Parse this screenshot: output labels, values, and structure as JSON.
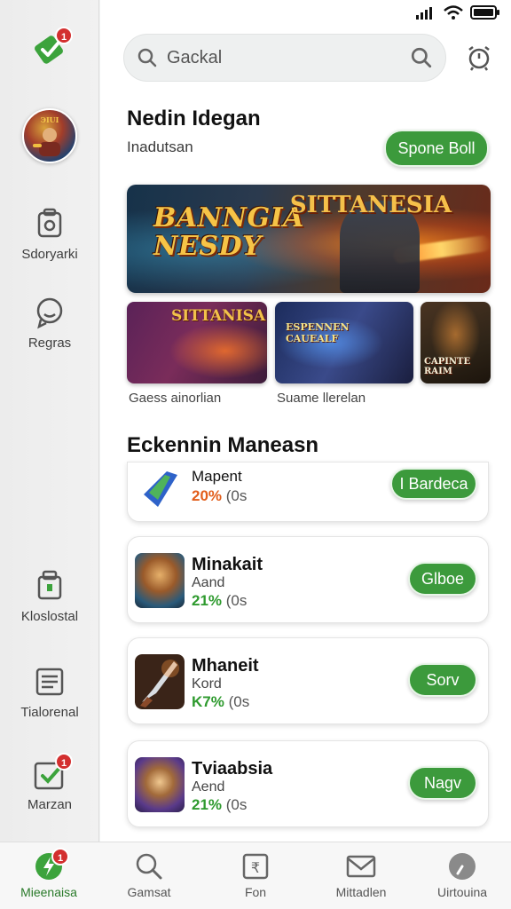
{
  "sidebar": {
    "items": [
      {
        "label": "",
        "icon": "check-tag-icon",
        "badge": "1"
      },
      {
        "label": "",
        "icon": "profile-avatar"
      },
      {
        "label": "Sdoryarki",
        "icon": "camera-icon"
      },
      {
        "label": "Regras",
        "icon": "chat-icon"
      },
      {
        "label": "Kloslostal",
        "icon": "lock-icon"
      },
      {
        "label": "Tialorenal",
        "icon": "document-icon"
      },
      {
        "label": "Marzan",
        "icon": "check-tag-icon",
        "badge": "1"
      }
    ]
  },
  "search": {
    "value": "Gackal"
  },
  "featured": {
    "title": "Nedin Idegan",
    "subtitle": "Inadutsan",
    "button": "Spone Boll",
    "banner_title": "BANNGIA NESDY",
    "banner_title_right": "SITTANESIA"
  },
  "thumbnails": [
    {
      "text": "SITTANISA"
    },
    {
      "text": "ESPENNEN CAUEALF"
    },
    {
      "text": "CAPINTE RAIM"
    }
  ],
  "thumb_captions": [
    "Gaess ainorlian",
    "Suame llerelan"
  ],
  "list_section": {
    "title": "Eckennin Maneasn"
  },
  "games": [
    {
      "name": "Mapent",
      "sub": "",
      "pct": "20%",
      "rest": "(0s",
      "pct_color": "#e25d1a",
      "button": "I Bardeca"
    },
    {
      "name": "Minakait",
      "sub": "Aand",
      "pct": "21%",
      "rest": "(0s",
      "pct_color": "#2e9a2e",
      "button": "Glboe"
    },
    {
      "name": "Mhaneit",
      "sub": "Kord",
      "pct": "K7%",
      "rest": "(0s",
      "pct_color": "#2e9a2e",
      "button": "Sorv"
    },
    {
      "name": "Tviaabsia",
      "sub": "Aend",
      "pct": "21%",
      "rest": "(0s",
      "pct_color": "#2e9a2e",
      "button": "Nagv"
    }
  ],
  "bottom_nav": [
    {
      "label": "Mieenaisa",
      "icon": "home-bolt-icon",
      "badge": "1",
      "active": true
    },
    {
      "label": "Gamsat",
      "icon": "search-icon"
    },
    {
      "label": "Fon",
      "icon": "wallet-icon"
    },
    {
      "label": "Mittadlen",
      "icon": "mail-icon"
    },
    {
      "label": "Uirtouina",
      "icon": "settings-icon"
    }
  ],
  "colors": {
    "accent": "#3c9a3c",
    "badge": "#d32f2f"
  }
}
